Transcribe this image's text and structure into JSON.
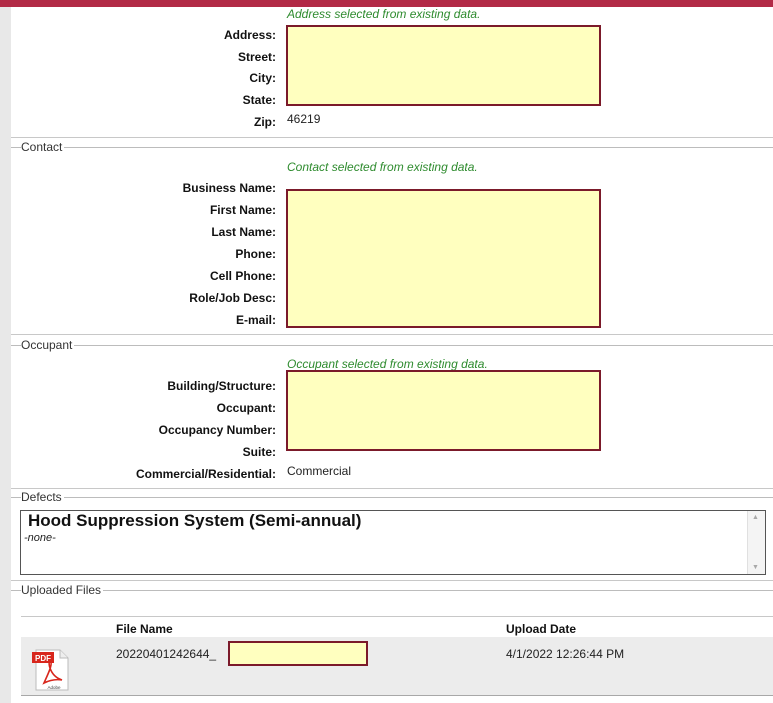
{
  "address": {
    "note": "Address selected from existing data.",
    "labels": {
      "address": "Address:",
      "street": "Street:",
      "city": "City:",
      "state": "State:",
      "zip": "Zip:"
    },
    "zip_value": "46219"
  },
  "contact": {
    "legend": "Contact",
    "note": "Contact selected from existing data.",
    "labels": {
      "business_name": "Business Name:",
      "first_name": "First Name:",
      "last_name": "Last Name:",
      "phone": "Phone:",
      "cell_phone": "Cell Phone:",
      "role": "Role/Job Desc:",
      "email": "E-mail:"
    }
  },
  "occupant": {
    "legend": "Occupant",
    "note": "Occupant selected from existing data.",
    "labels": {
      "building": "Building/Structure:",
      "occupant": "Occupant:",
      "occupancy_number": "Occupancy Number:",
      "suite": "Suite:",
      "commercial": "Commercial/Residential:"
    },
    "commercial_value": "Commercial"
  },
  "defects": {
    "legend": "Defects",
    "title": "Hood Suppression System (Semi-annual)",
    "subtitle": "-none-"
  },
  "files": {
    "legend": "Uploaded Files",
    "columns": {
      "file_name": "File Name",
      "upload_date": "Upload Date"
    },
    "rows": [
      {
        "file_name": "20220401242644_",
        "upload_date": "4/1/2022 12:26:44 PM",
        "icon_text": "PDF",
        "icon_brand": "Adobe"
      }
    ]
  },
  "colors": {
    "accent": "#b22a46",
    "redaction_fill": "#ffffbf",
    "redaction_border": "#7b1a2a",
    "note_green": "#2e8b2e"
  }
}
